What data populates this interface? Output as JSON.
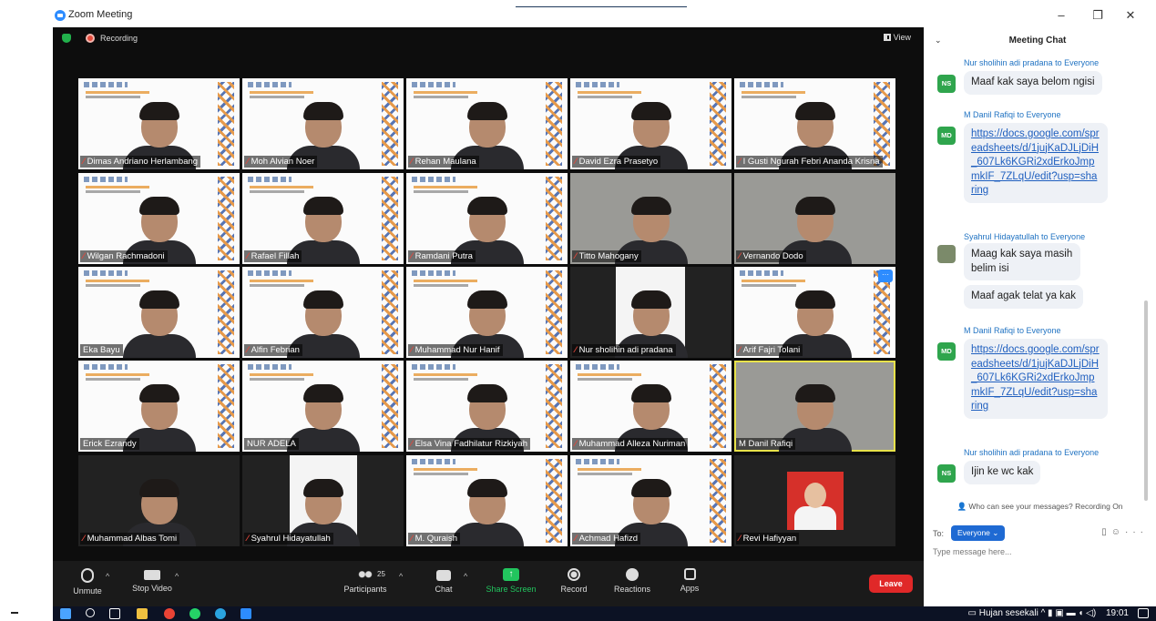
{
  "window": {
    "title": "Zoom Meeting"
  },
  "meeting": {
    "recording_label": "Recording",
    "view_label": "View"
  },
  "participants": [
    {
      "name": "Dimas Andriano Herlambang"
    },
    {
      "name": "Moh Alvian Noer"
    },
    {
      "name": "Rehan Maulana"
    },
    {
      "name": "David Ezra Prasetyo"
    },
    {
      "name": "I Gusti Ngurah Febri Ananda Krisna"
    },
    {
      "name": "Wilgan Rachmadoni"
    },
    {
      "name": "Rafael Fillah"
    },
    {
      "name": "Ramdani Putra"
    },
    {
      "name": "Titto Mahogany"
    },
    {
      "name": "Vernando Dodo"
    },
    {
      "name": "Eka Bayu"
    },
    {
      "name": "Alfin Febrian"
    },
    {
      "name": "Muhammad Nur Hanif"
    },
    {
      "name": "Nur sholihin adi pradana"
    },
    {
      "name": "Arif Fajri Tolani"
    },
    {
      "name": "Erick Ezrandy"
    },
    {
      "name": "NUR ADELA"
    },
    {
      "name": "Elsa Vina Fadhilatur Rizkiyah"
    },
    {
      "name": "Muhammad Alleza Nuriman"
    },
    {
      "name": "M Danil Rafiqi"
    },
    {
      "name": "Muhammad Albas Tomi"
    },
    {
      "name": "Syahrul Hidayatullah"
    },
    {
      "name": "M. Quraish"
    },
    {
      "name": "Achmad Hafizd"
    },
    {
      "name": "Revi Hafiyyan"
    }
  ],
  "toolbar": {
    "unmute": "Unmute",
    "stop_video": "Stop Video",
    "participants": "Participants",
    "participant_count": "25",
    "chat": "Chat",
    "share_screen": "Share Screen",
    "record": "Record",
    "reactions": "Reactions",
    "apps": "Apps",
    "leave": "Leave"
  },
  "chat": {
    "title": "Meeting Chat",
    "messages": [
      {
        "sender": "Nur sholihin adi pradana to Everyone",
        "initials": "NS",
        "texts": [
          "Maaf kak saya belom ngisi"
        ]
      },
      {
        "sender": "M Danil Rafiqi to Everyone",
        "initials": "MD",
        "texts": [
          "https://docs.google.com/spreadsheets/d/1jujKaDJLjDiH_607Lk6KGRi2xdErkoJmpmkIF_7ZLqU/edit?usp=sharing"
        ]
      },
      {
        "sender": "Syahrul Hidayatullah to Everyone",
        "initials": "",
        "texts": [
          "Maag kak saya masih belim isi",
          "Maaf agak telat ya kak"
        ]
      },
      {
        "sender": "M Danil Rafiqi to Everyone",
        "initials": "MD",
        "texts": [
          "https://docs.google.com/spreadsheets/d/1jujKaDJLjDiH_607Lk6KGRi2xdErkoJmpmkIF_7ZLqU/edit?usp=sharing"
        ]
      },
      {
        "sender": "Nur sholihin adi pradana to Everyone",
        "initials": "NS",
        "texts": [
          "Ijin ke wc kak"
        ]
      }
    ],
    "notice": "Who can see your messages? Recording On",
    "to_label": "To:",
    "recipient": "Everyone",
    "input_placeholder": "Type message here..."
  },
  "taskbar": {
    "weather": "Hujan sesekali",
    "time": "19:01"
  },
  "colors": {
    "zoom_blue": "#2d8cff",
    "share_green": "#22c55e",
    "leave_red": "#e02828",
    "active_speaker": "#e8e24a"
  }
}
